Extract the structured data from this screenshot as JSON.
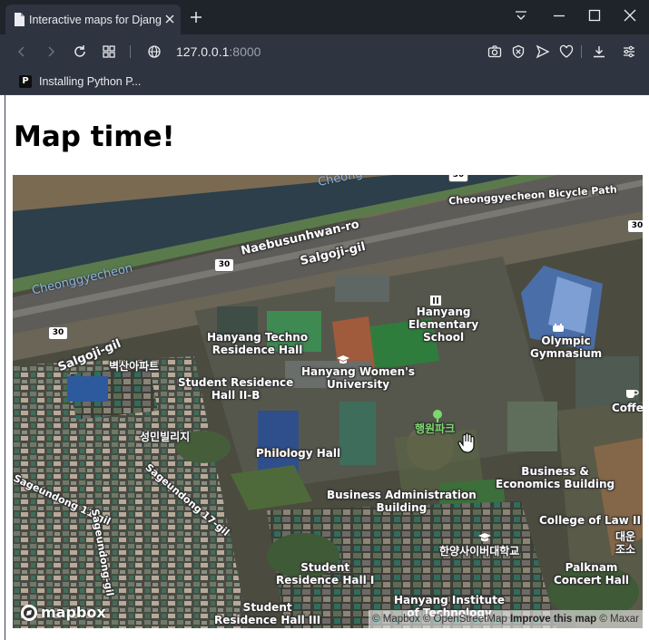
{
  "browser": {
    "tab_title": "Interactive maps for Django",
    "url_host": "127.0.0.1",
    "url_port": ":8000",
    "bookmark_label": "Installing Python P...",
    "bookmark_favicon_letter": "P"
  },
  "page": {
    "title": "Map time!"
  },
  "map": {
    "roads": {
      "naebusunhwan": "Naebusunhwan-ro",
      "salgoji_upper": "Salgoji-gil",
      "salgoji_left": "Salgoji-gil",
      "bicycle_path": "Cheonggyecheon Bicycle Path",
      "sageundong_17": "Sageundong 17-gil",
      "sageundong_11": "Sageundong 11-gil",
      "sageundong_gil": "Sageundong-gil",
      "cheong_top": "Cheong"
    },
    "water": {
      "cheonggyecheon": "Cheonggyecheon"
    },
    "shields": [
      "30",
      "30",
      "30",
      "30"
    ],
    "places": {
      "techno_hall": "Hanyang Techno\nResidence Hall",
      "elementary": "Hanyang\nElementary\nSchool",
      "womens_univ": "Hanyang Women's\nUniversity",
      "olympic_gym": "Olympic\nGymnasium",
      "student_res_2b": "Student Residence\nHall II-B",
      "byeoksan": "벽산아파트",
      "seongmin": "성민빌리지",
      "philology": "Philology Hall",
      "haengwon_park": "행원파크",
      "coffee": "Coffee Q",
      "business_econ": "Business &\nEconomics Building",
      "business_admin": "Business Administration\nBuilding",
      "college_law": "College of Law II",
      "daeun": "대운\n조소",
      "hanyang_univ_kr": "한양사이버대학교",
      "student_res_1": "Student\nResidence Hall I",
      "palknam": "Palknam\nConcert Hall",
      "institute_tech": "Hanyang Institute\nof Technology",
      "student_res_3": "Student\nResidence Hall III"
    },
    "logo_text": "mapbox",
    "attribution": {
      "mapbox": "© Mapbox",
      "osm": "© OpenStreetMap",
      "improve": "Improve this map",
      "maxar": "© Maxar"
    }
  },
  "colors": {
    "chrome_dark": "#1f232a",
    "chrome": "#2e3440",
    "water": "#2c3f4a",
    "vegetation": "#3f5a36",
    "field": "#3b7a3f"
  }
}
